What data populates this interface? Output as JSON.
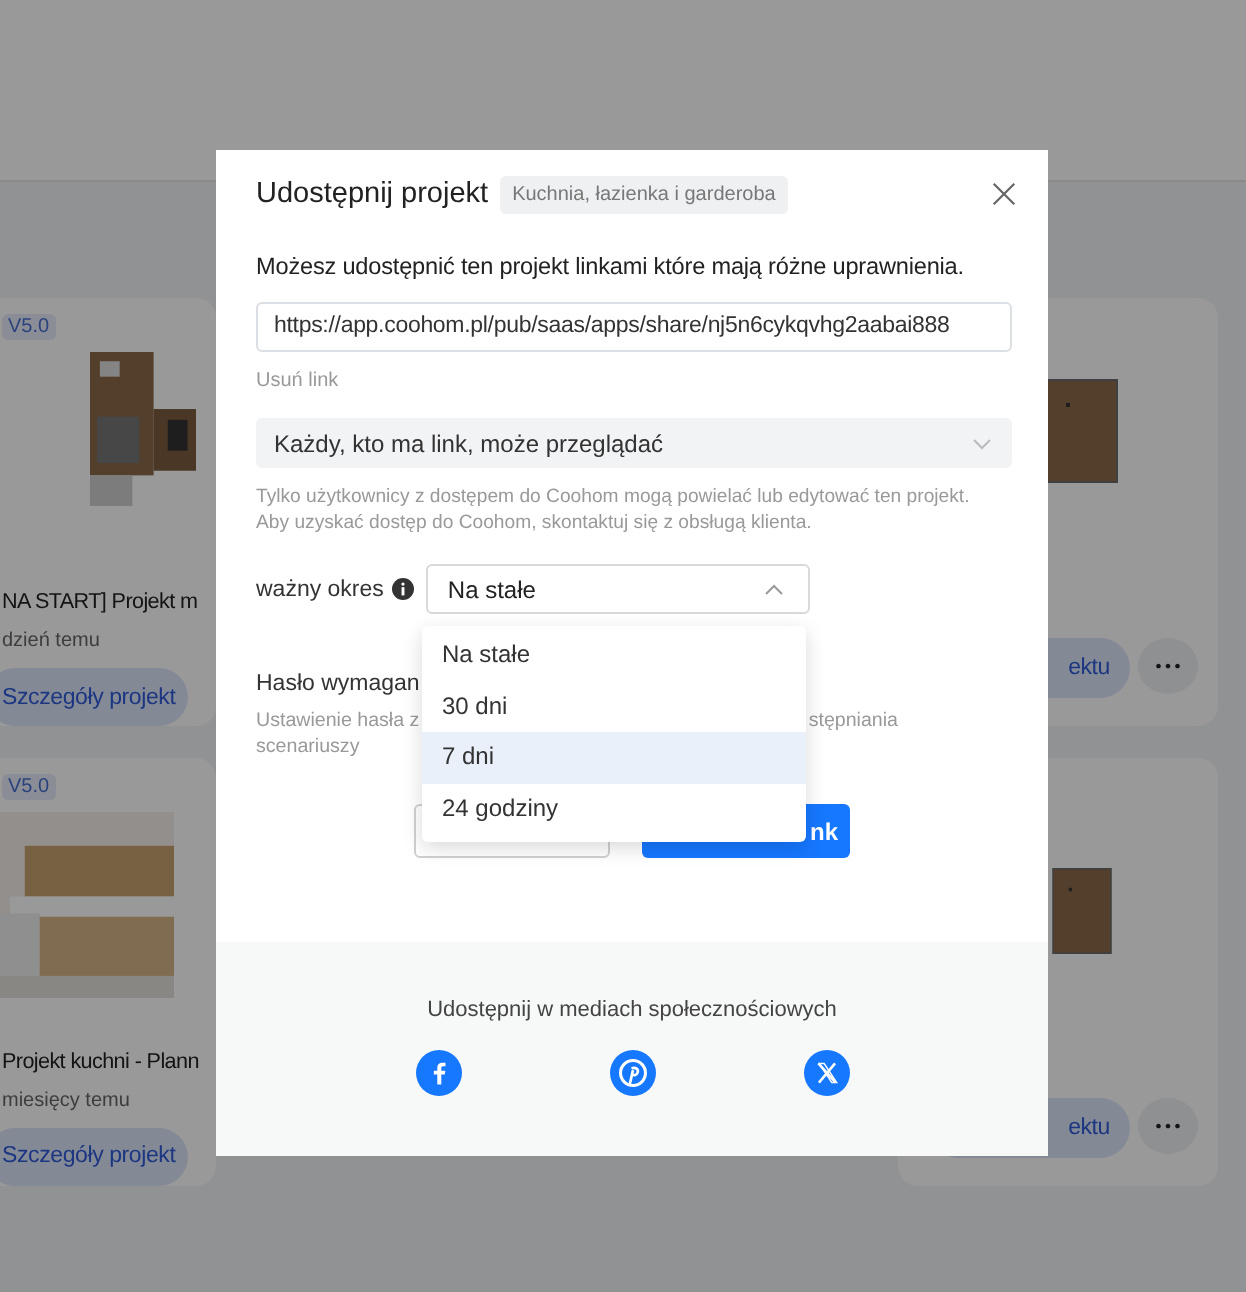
{
  "background": {
    "left_cards": [
      {
        "badge": "V5.0",
        "title": "NA START] Projekt m",
        "time": "dzień temu",
        "button": "Szczegóły projekt"
      },
      {
        "badge": "V5.0",
        "title": "Projekt kuchni - Plann",
        "time": "miesięcy temu",
        "button": "Szczegóły projekt"
      }
    ],
    "right_cards": [
      {
        "button": "ektu",
        "more": "•••"
      },
      {
        "button": "ektu",
        "more": "•••"
      }
    ]
  },
  "dialog": {
    "title": "Udostępnij projekt",
    "tag": "Kuchnia, łazienka i garderoba",
    "intro": "Możesz udostępnić ten projekt linkami które mają różne uprawnienia.",
    "link_field": {
      "value": "https://app.coohom.pl/pub/saas/apps/share/nj5n6cykqvhg2aabai888"
    },
    "remove_link": "Usuń link",
    "permission": {
      "value": "Każdy, kto ma link, może przeglądać"
    },
    "permission_note": "Tylko użytkownicy z dostępem do Coohom mogą powielać lub edytować ten projekt. Aby uzyskać dostęp do Coohom, skontaktuj się z obsługą klienta.",
    "validity": {
      "label": "ważny okres",
      "value": "Na stałe",
      "expanded": true,
      "options": [
        {
          "label": "Na stałe",
          "highlighted": false
        },
        {
          "label": "30 dni",
          "highlighted": false
        },
        {
          "label": "7 dni",
          "highlighted": true
        },
        {
          "label": "24 godziny",
          "highlighted": false
        }
      ]
    },
    "password": {
      "label": "Hasło wymagan",
      "note_start": "Ustawienie hasła z",
      "note_end": "stępniania",
      "note_line2": "scenariuszy"
    },
    "buttons": [
      {
        "kind": "secondary"
      },
      {
        "kind": "primary",
        "label": "nk"
      }
    ],
    "social": {
      "heading": "Udostępnij w mediach społecznościowych",
      "networks": [
        {
          "kind": "facebook"
        },
        {
          "kind": "pinterest"
        },
        {
          "kind": "x"
        }
      ]
    }
  }
}
